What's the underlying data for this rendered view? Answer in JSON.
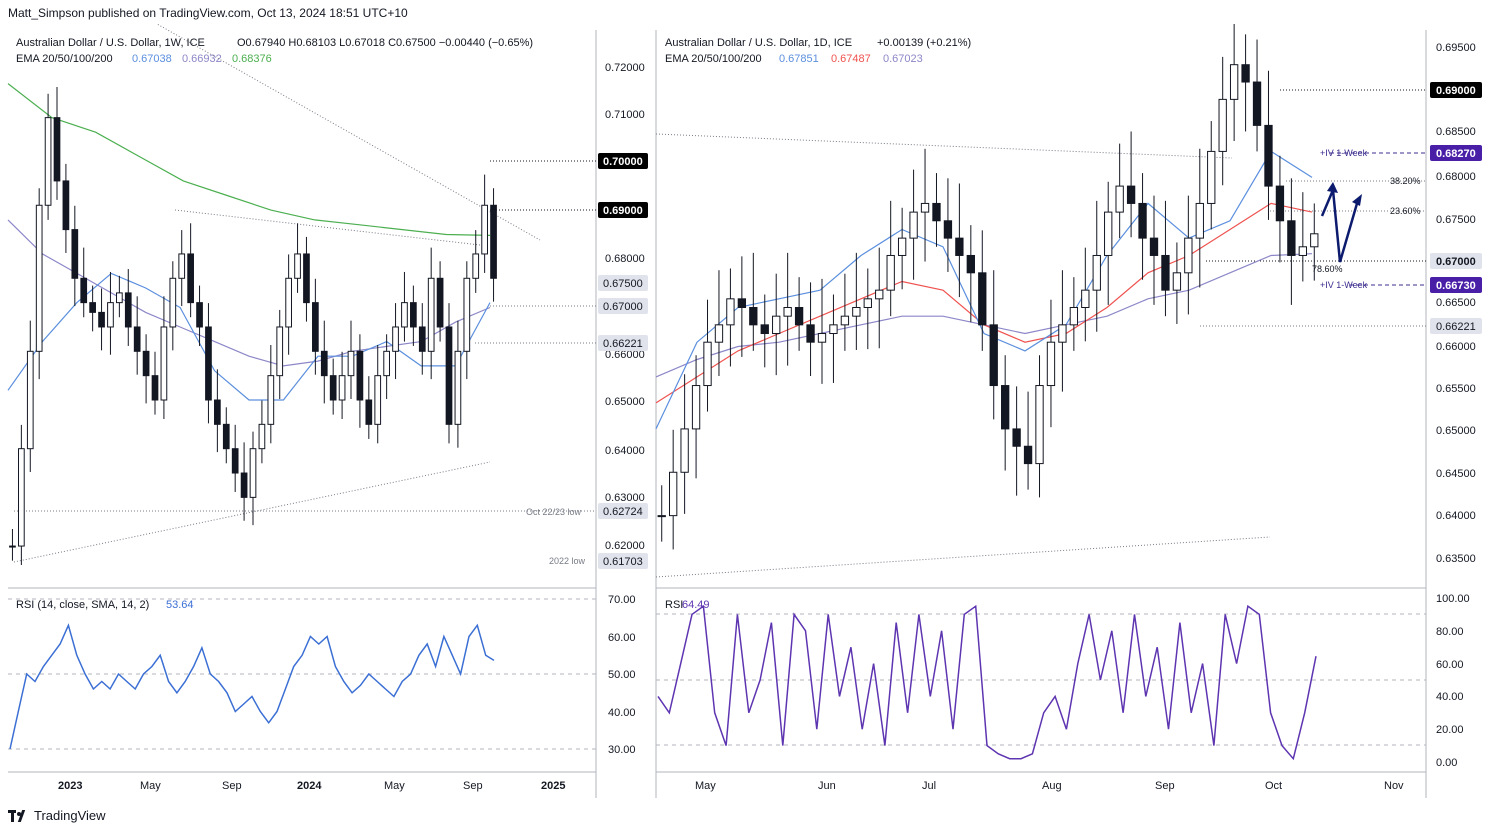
{
  "header": {
    "publisher": "Matt_Simpson published on TradingView.com, Oct 13, 2024 18:51 UTC+10"
  },
  "footer": {
    "brand": "TradingView"
  },
  "colors": {
    "ema20": "#5b8fde",
    "ema50_weekly": "#8c87c8",
    "ema200": "#4caf50",
    "ema50_daily": "#ef5350",
    "ema100_daily": "#8c87c8",
    "rsi_weekly": "#3b6fd4",
    "rsi_daily": "#5e35b1",
    "candle": "#131722"
  },
  "left": {
    "title": "Australian Dollar / U.S. Dollar, 1W, ICE",
    "ohlc": "O0.67940  H0.68103  L0.67018  C0.67500  −0.00440 (−0.65%)",
    "ema_label": "EMA 20/50/100/200",
    "ema_values": [
      "0.67038",
      "0.66932",
      "0.68376"
    ],
    "price_ticks": [
      "0.72000",
      "0.71000",
      "0.68000",
      "0.66000",
      "0.65000",
      "0.64000",
      "0.63000",
      "0.62000"
    ],
    "tags": [
      "0.70000",
      "0.69000",
      "0.67500",
      "0.67000",
      "0.66221",
      "0.62724",
      "0.61703"
    ],
    "notes": [
      "Oct 22/23 low",
      "2022 low"
    ],
    "rsi_label": "RSI (14, close, SMA, 14, 2)",
    "rsi_value": "53.64",
    "rsi_ticks": [
      "70.00",
      "60.00",
      "50.00",
      "40.00",
      "30.00"
    ],
    "time_ticks": [
      "2023",
      "May",
      "Sep",
      "2024",
      "May",
      "Sep",
      "2025"
    ]
  },
  "right": {
    "title": "Australian Dollar / U.S. Dollar, 1D, ICE",
    "change": "+0.00139 (+0.21%)",
    "ema_label": "EMA 20/50/100/200",
    "ema_values": [
      "0.67851",
      "0.67487",
      "0.67023"
    ],
    "price_ticks": [
      "0.69500",
      "0.68500",
      "0.68000",
      "0.67500",
      "0.66500",
      "0.66000",
      "0.65500",
      "0.65000",
      "0.64500",
      "0.64000",
      "0.63500"
    ],
    "tags": [
      "0.69000",
      "0.68270",
      "0.67000",
      "0.66730",
      "0.66221"
    ],
    "iv_label": "+IV 1-Week",
    "fib": [
      "38.20%",
      "23.60%",
      "78.60%"
    ],
    "rsi_label": "RSI",
    "rsi_value": "64.49",
    "rsi_ticks": [
      "100.00",
      "80.00",
      "60.00",
      "40.00",
      "20.00",
      "0.00"
    ],
    "time_ticks": [
      "May",
      "Jun",
      "Jul",
      "Aug",
      "Sep",
      "Oct",
      "Nov"
    ]
  },
  "chart_data": [
    {
      "type": "candlestick",
      "title": "Australian Dollar / U.S. Dollar, 1W, ICE",
      "ylim": [
        0.612,
        0.726
      ],
      "series_close_weekly_approx": [
        0.62,
        0.64,
        0.66,
        0.69,
        0.708,
        0.695,
        0.685,
        0.675,
        0.67,
        0.668,
        0.665,
        0.67,
        0.672,
        0.665,
        0.66,
        0.655,
        0.65,
        0.665,
        0.675,
        0.68,
        0.67,
        0.665,
        0.65,
        0.645,
        0.64,
        0.635,
        0.63,
        0.64,
        0.645,
        0.655,
        0.665,
        0.675,
        0.68,
        0.67,
        0.66,
        0.655,
        0.65,
        0.655,
        0.66,
        0.65,
        0.645,
        0.655,
        0.66,
        0.665,
        0.67,
        0.665,
        0.66,
        0.675,
        0.665,
        0.645,
        0.66,
        0.675,
        0.68,
        0.69,
        0.675
      ],
      "ema20": [
        0.652,
        0.662,
        0.67,
        0.676,
        0.673,
        0.669,
        0.656,
        0.65,
        0.65,
        0.659,
        0.659,
        0.662,
        0.657,
        0.657,
        0.67
      ],
      "ema50": [
        0.687,
        0.68,
        0.676,
        0.672,
        0.668,
        0.665,
        0.662,
        0.659,
        0.657,
        0.658,
        0.66,
        0.661,
        0.662,
        0.666,
        0.669
      ],
      "ema200": [
        0.715,
        0.708,
        0.705,
        0.7,
        0.695,
        0.692,
        0.689,
        0.687,
        0.686,
        0.685,
        0.684,
        0.6838
      ]
    },
    {
      "type": "line",
      "title": "RSI (14, close, SMA, 14, 2)",
      "values": [
        30,
        40,
        50,
        48,
        52,
        55,
        58,
        63,
        55,
        50,
        46,
        48,
        46,
        50,
        48,
        46,
        50,
        52,
        55,
        48,
        45,
        48,
        52,
        57,
        50,
        48,
        45,
        40,
        42,
        44,
        40,
        37,
        40,
        46,
        52,
        55,
        60,
        58,
        60,
        52,
        48,
        45,
        47,
        50,
        48,
        46,
        44,
        48,
        50,
        55,
        58,
        52,
        60,
        55,
        50,
        60,
        63,
        55,
        53.64
      ],
      "ylim": [
        25,
        72
      ]
    },
    {
      "type": "candlestick",
      "title": "Australian Dollar / U.S. Dollar, 1D, ICE",
      "ylim": [
        0.632,
        0.696
      ],
      "close_daily_approx": [
        0.64,
        0.645,
        0.65,
        0.655,
        0.66,
        0.662,
        0.665,
        0.664,
        0.662,
        0.661,
        0.663,
        0.664,
        0.662,
        0.66,
        0.661,
        0.662,
        0.663,
        0.664,
        0.665,
        0.666,
        0.67,
        0.672,
        0.675,
        0.676,
        0.674,
        0.672,
        0.67,
        0.668,
        0.662,
        0.655,
        0.65,
        0.648,
        0.646,
        0.655,
        0.66,
        0.662,
        0.664,
        0.666,
        0.67,
        0.675,
        0.678,
        0.676,
        0.672,
        0.67,
        0.666,
        0.668,
        0.672,
        0.676,
        0.682,
        0.688,
        0.692,
        0.69,
        0.685,
        0.678,
        0.674,
        0.67,
        0.671,
        0.6725
      ],
      "ema20": [
        0.65,
        0.66,
        0.664,
        0.665,
        0.666,
        0.67,
        0.673,
        0.671,
        0.661,
        0.659,
        0.662,
        0.67,
        0.676,
        0.672,
        0.674,
        0.682,
        0.679
      ],
      "ema50": [
        0.653,
        0.656,
        0.659,
        0.661,
        0.663,
        0.665,
        0.667,
        0.666,
        0.662,
        0.66,
        0.661,
        0.664,
        0.668,
        0.67,
        0.673,
        0.676,
        0.675
      ],
      "ema100": [
        0.656,
        0.658,
        0.6595,
        0.66,
        0.661,
        0.662,
        0.663,
        0.663,
        0.662,
        0.661,
        0.662,
        0.663,
        0.665,
        0.666,
        0.668,
        0.67,
        0.6702
      ]
    },
    {
      "type": "line",
      "title": "RSI",
      "values": [
        40,
        30,
        60,
        90,
        95,
        30,
        10,
        90,
        30,
        50,
        85,
        10,
        90,
        80,
        20,
        90,
        40,
        70,
        20,
        60,
        10,
        85,
        30,
        90,
        40,
        80,
        20,
        90,
        95,
        10,
        5,
        2,
        2,
        5,
        30,
        40,
        20,
        60,
        90,
        50,
        80,
        30,
        90,
        40,
        70,
        20,
        85,
        30,
        60,
        10,
        90,
        60,
        95,
        90,
        30,
        10,
        2,
        30,
        64.49
      ],
      "ylim": [
        -5,
        102
      ]
    }
  ]
}
